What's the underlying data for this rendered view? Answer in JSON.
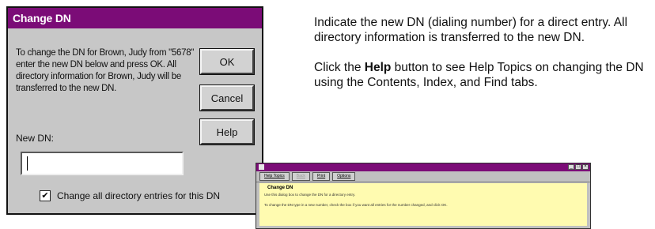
{
  "dialog": {
    "title": "Change DN",
    "message": "To change the DN for Brown, Judy from \"5678\" enter the new DN below and press OK. All directory information for Brown, Judy will be transferred to the new DN.",
    "ok_label": "OK",
    "cancel_label": "Cancel",
    "help_label": "Help",
    "new_dn_label": "New DN:",
    "new_dn_value": "",
    "checkbox_label": "Change all directory entries for this DN",
    "checkbox_checked": true,
    "checkbox_mark": "✔"
  },
  "instructions": {
    "paragraph1": "Indicate the new DN (dialing number) for a direct entry. All directory information is transferred to the new DN.",
    "p2_before": "Click the ",
    "p2_bold": "Help",
    "p2_after": " button to see Help Topics on changing the DN using the Contents, Index, and Find tabs."
  },
  "help_window": {
    "toolbar": [
      {
        "label": "Help Topics",
        "disabled": false
      },
      {
        "label": "Back",
        "disabled": true
      },
      {
        "label": "Print",
        "disabled": false
      },
      {
        "label": "Options",
        "disabled": false
      }
    ],
    "heading": "Change DN",
    "line1": "Use this dialog box to change the DN for a directory entry.",
    "line2": "To change the DN type in a new number, check the box if you want all entries for the number changed, and click OK."
  },
  "colors": {
    "titlebar": "#7b0c77",
    "dialog_bg": "#c7c7c7",
    "help_bg": "#fffbb0"
  }
}
